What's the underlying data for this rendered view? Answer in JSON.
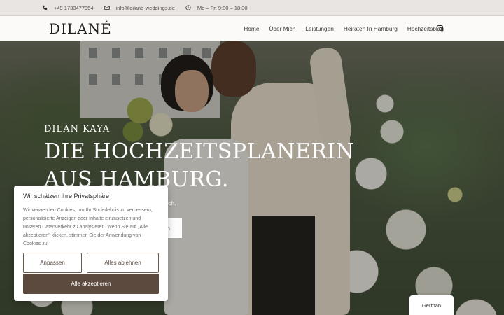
{
  "topbar": {
    "phone": "+49 1733477954",
    "email": "info@dilane-weddings.de",
    "hours": "Mo – Fr: 9:00 – 18:30"
  },
  "nav": {
    "logo": "DILANÉ",
    "items": [
      "Home",
      "Über Mich",
      "Leistungen",
      "Heiraten In Hamburg",
      "Hochzeitsblog"
    ]
  },
  "hero": {
    "eyebrow": "DILAN KAYA",
    "headline": "DIE HOCHZEITSPLANERIN AUS HAMBURG.",
    "subtext_partial": "isch.",
    "cta_partial": "n"
  },
  "cookie": {
    "title": "Wir schätzen Ihre Privatsphäre",
    "body": "Wir verwenden Cookies, um Ihr Surferlebnis zu verbessern, personalisierte Anzeigen oder Inhalte einzusetzen und unseren Datenverkehr zu analysieren. Wenn Sie auf „Alle akzeptieren\" klicken, stimmen Sie der Anwendung von Cookies zu.",
    "customize": "Anpassen",
    "reject": "Alles ablehnen",
    "accept": "Alle akzeptieren"
  },
  "language": "German",
  "colors": {
    "accent": "#5c4a3e",
    "topbar_bg": "#e9e5e2",
    "nav_bg": "#fbfaf8"
  }
}
